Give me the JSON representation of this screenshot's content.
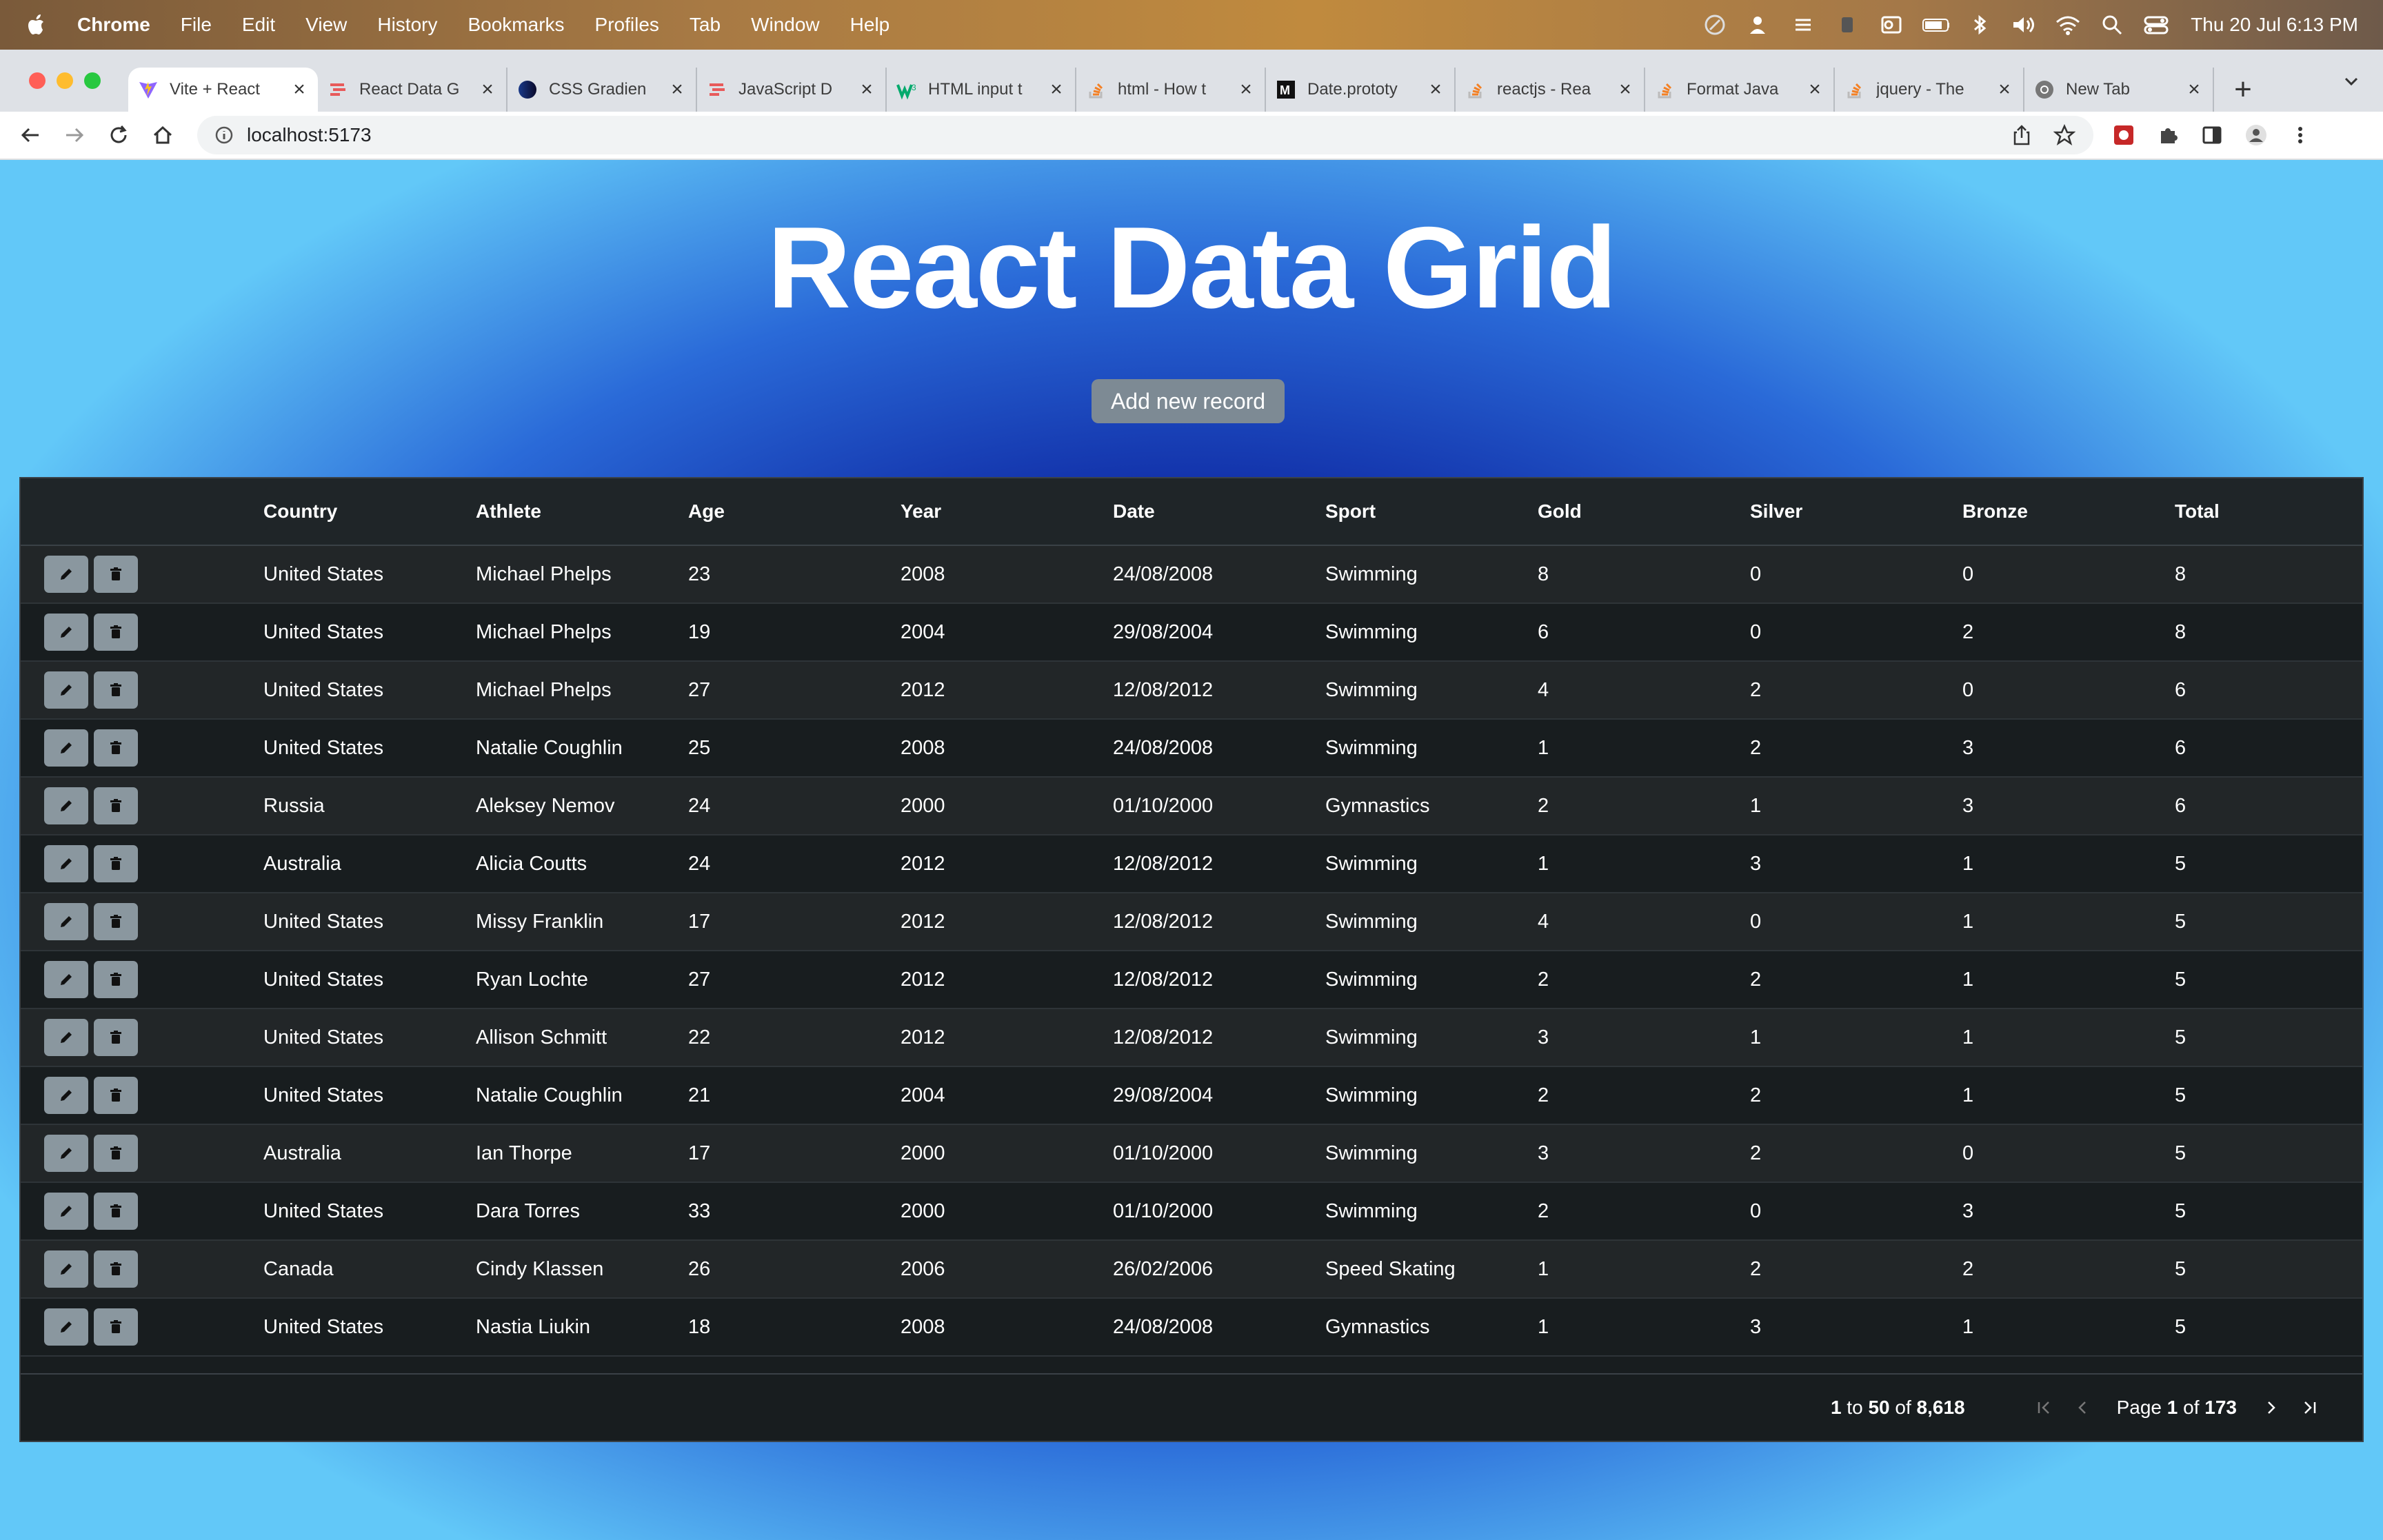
{
  "menubar": {
    "app_name": "Chrome",
    "items": [
      "File",
      "Edit",
      "View",
      "History",
      "Bookmarks",
      "Profiles",
      "Tab",
      "Window",
      "Help"
    ],
    "clock": "Thu 20 Jul  6:13 PM"
  },
  "tabs": [
    {
      "label": "Vite + React",
      "icon": "vite-icon",
      "active": true
    },
    {
      "label": "React Data G",
      "icon": "aggrid-icon"
    },
    {
      "label": "CSS Gradien",
      "icon": "css-gradient-icon"
    },
    {
      "label": "JavaScript D",
      "icon": "aggrid-icon"
    },
    {
      "label": "HTML input t",
      "icon": "w3schools-icon"
    },
    {
      "label": "html - How t",
      "icon": "stackoverflow-icon"
    },
    {
      "label": "Date.prototy",
      "icon": "mdn-icon"
    },
    {
      "label": "reactjs - Rea",
      "icon": "stackoverflow-icon"
    },
    {
      "label": "Format Java",
      "icon": "stackoverflow-icon"
    },
    {
      "label": "jquery - The",
      "icon": "stackoverflow-icon"
    },
    {
      "label": "New Tab",
      "icon": "chrome-icon"
    }
  ],
  "address_bar": {
    "url": "localhost:5173"
  },
  "page": {
    "title": "React Data Grid",
    "add_button": "Add new record"
  },
  "grid": {
    "columns": [
      "Country",
      "Athlete",
      "Age",
      "Year",
      "Date",
      "Sport",
      "Gold",
      "Silver",
      "Bronze",
      "Total"
    ],
    "rows": [
      [
        "United States",
        "Michael Phelps",
        "23",
        "2008",
        "24/08/2008",
        "Swimming",
        "8",
        "0",
        "0",
        "8"
      ],
      [
        "United States",
        "Michael Phelps",
        "19",
        "2004",
        "29/08/2004",
        "Swimming",
        "6",
        "0",
        "2",
        "8"
      ],
      [
        "United States",
        "Michael Phelps",
        "27",
        "2012",
        "12/08/2012",
        "Swimming",
        "4",
        "2",
        "0",
        "6"
      ],
      [
        "United States",
        "Natalie Coughlin",
        "25",
        "2008",
        "24/08/2008",
        "Swimming",
        "1",
        "2",
        "3",
        "6"
      ],
      [
        "Russia",
        "Aleksey Nemov",
        "24",
        "2000",
        "01/10/2000",
        "Gymnastics",
        "2",
        "1",
        "3",
        "6"
      ],
      [
        "Australia",
        "Alicia Coutts",
        "24",
        "2012",
        "12/08/2012",
        "Swimming",
        "1",
        "3",
        "1",
        "5"
      ],
      [
        "United States",
        "Missy Franklin",
        "17",
        "2012",
        "12/08/2012",
        "Swimming",
        "4",
        "0",
        "1",
        "5"
      ],
      [
        "United States",
        "Ryan Lochte",
        "27",
        "2012",
        "12/08/2012",
        "Swimming",
        "2",
        "2",
        "1",
        "5"
      ],
      [
        "United States",
        "Allison Schmitt",
        "22",
        "2012",
        "12/08/2012",
        "Swimming",
        "3",
        "1",
        "1",
        "5"
      ],
      [
        "United States",
        "Natalie Coughlin",
        "21",
        "2004",
        "29/08/2004",
        "Swimming",
        "2",
        "2",
        "1",
        "5"
      ],
      [
        "Australia",
        "Ian Thorpe",
        "17",
        "2000",
        "01/10/2000",
        "Swimming",
        "3",
        "2",
        "0",
        "5"
      ],
      [
        "United States",
        "Dara Torres",
        "33",
        "2000",
        "01/10/2000",
        "Swimming",
        "2",
        "0",
        "3",
        "5"
      ],
      [
        "Canada",
        "Cindy Klassen",
        "26",
        "2006",
        "26/02/2006",
        "Speed Skating",
        "1",
        "2",
        "2",
        "5"
      ],
      [
        "United States",
        "Nastia Liukin",
        "18",
        "2008",
        "24/08/2008",
        "Gymnastics",
        "1",
        "3",
        "1",
        "5"
      ]
    ],
    "footer": {
      "row_from": "1",
      "to_word": "to",
      "row_to": "50",
      "of_word": "of",
      "row_count": "8,618",
      "page_word": "Page",
      "page_current": "1",
      "page_of": "of",
      "page_total": "173"
    }
  },
  "colors": {
    "grid_bg": "#181d1f",
    "grid_row_alt": "#222628",
    "button_grey": "#8a979f",
    "page_gradient_center": "#020a6e",
    "page_gradient_edge": "#62c8f8"
  }
}
